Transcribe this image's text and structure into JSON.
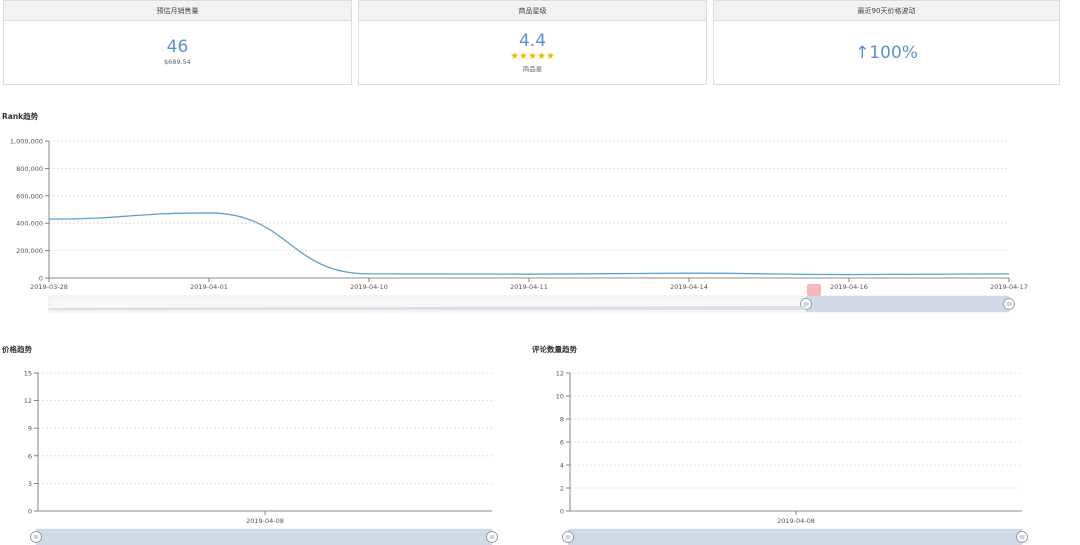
{
  "cards": [
    {
      "title": "预估月销售量",
      "value": "46",
      "sub": "$689.54"
    },
    {
      "title": "商品星级",
      "value": "4.4",
      "stars": "★★★★★",
      "sub": "商品星"
    },
    {
      "title": "最近90天价格波动",
      "value": "↑100%"
    }
  ],
  "colors": {
    "accent": "#5b8fd6",
    "line": "#5ba3cf",
    "grid": "#d8d8d8",
    "star": "#f5b800",
    "slider": "#c9d3e3"
  },
  "chart_data": [
    {
      "type": "line",
      "title": "Rank趋势",
      "categories": [
        "2019-03-28",
        "2019-04-01",
        "2019-04-10",
        "2019-04-11",
        "2019-04-14",
        "2019-04-16",
        "2019-04-17"
      ],
      "series": [
        {
          "values": [
            430000,
            475000,
            30000,
            28000,
            35000,
            25000,
            30000
          ]
        }
      ],
      "y_ticks": [
        "1,000,000",
        "800,000",
        "600,000",
        "400,000",
        "200,000",
        "0"
      ],
      "ylim": [
        0,
        1000000
      ],
      "grid": true
    },
    {
      "type": "line",
      "title": "价格趋势",
      "categories": [
        "2019-04-08"
      ],
      "series": [],
      "y_ticks": [
        "15",
        "12",
        "9",
        "6",
        "3",
        "0"
      ],
      "ylim": [
        0,
        15
      ],
      "grid": true
    },
    {
      "type": "line",
      "title": "评论数量趋势",
      "categories": [
        "2019-04-08"
      ],
      "series": [],
      "y_ticks": [
        "12",
        "10",
        "8",
        "6",
        "4",
        "2",
        "0"
      ],
      "ylim": [
        0,
        12
      ],
      "grid": true
    }
  ]
}
